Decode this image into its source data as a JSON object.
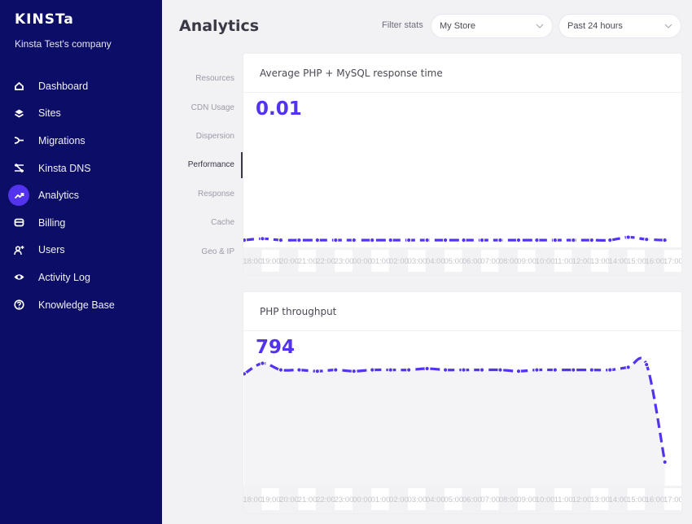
{
  "sidebar": {
    "logo": "KINSTa",
    "company": "Kinsta Test's company",
    "items": [
      {
        "label": "Dashboard",
        "icon": "home-icon",
        "active": false
      },
      {
        "label": "Sites",
        "icon": "layers-icon",
        "active": false
      },
      {
        "label": "Migrations",
        "icon": "migrate-icon",
        "active": false
      },
      {
        "label": "Kinsta DNS",
        "icon": "dns-icon",
        "active": false
      },
      {
        "label": "Analytics",
        "icon": "trend-up-icon",
        "active": true
      },
      {
        "label": "Billing",
        "icon": "card-icon",
        "active": false
      },
      {
        "label": "Users",
        "icon": "add-user-icon",
        "active": false
      },
      {
        "label": "Activity Log",
        "icon": "eye-icon",
        "active": false
      },
      {
        "label": "Knowledge Base",
        "icon": "help-icon",
        "active": false
      }
    ]
  },
  "header": {
    "title": "Analytics",
    "filter_label": "Filter stats",
    "site_select": "My Store",
    "range_select": "Past 24 hours"
  },
  "subnav": {
    "items": [
      {
        "label": "Resources",
        "active": false
      },
      {
        "label": "CDN Usage",
        "active": false
      },
      {
        "label": "Dispersion",
        "active": false
      },
      {
        "label": "Performance",
        "active": true
      },
      {
        "label": "Response",
        "active": false
      },
      {
        "label": "Cache",
        "active": false
      },
      {
        "label": "Geo & IP",
        "active": false
      }
    ]
  },
  "colors": {
    "accent": "#5333ed",
    "sidebar": "#0b0d66"
  },
  "cards": [
    {
      "title": "Average PHP + MySQL response time",
      "value": "0.01"
    },
    {
      "title": "PHP throughput",
      "value": "794"
    }
  ],
  "chart_data": [
    {
      "type": "line",
      "title": "Average PHP + MySQL response time",
      "xlabel": "",
      "ylabel": "",
      "x": [
        "18:00",
        "19:00",
        "20:00",
        "21:00",
        "22:00",
        "23:00",
        "00:00",
        "01:00",
        "02:00",
        "03:00",
        "04:00",
        "05:00",
        "06:00",
        "07:00",
        "08:00",
        "09:00",
        "10:00",
        "11:00",
        "12:00",
        "13:00",
        "14:00",
        "15:00",
        "16:00",
        "17:00"
      ],
      "series": [
        {
          "name": "Average PHP + MySQL response time",
          "values": [
            0.01,
            0.012,
            0.01,
            0.01,
            0.01,
            0.01,
            0.01,
            0.01,
            0.01,
            0.01,
            0.01,
            0.01,
            0.01,
            0.01,
            0.01,
            0.01,
            0.01,
            0.01,
            0.01,
            0.01,
            0.01,
            0.014,
            0.011,
            0.01
          ]
        }
      ],
      "ylim": [
        0,
        0.2
      ],
      "grid": false,
      "legend": "none"
    },
    {
      "type": "area",
      "title": "PHP throughput",
      "xlabel": "",
      "ylabel": "",
      "x": [
        "18:00",
        "19:00",
        "20:00",
        "21:00",
        "22:00",
        "23:00",
        "00:00",
        "01:00",
        "02:00",
        "03:00",
        "04:00",
        "05:00",
        "06:00",
        "07:00",
        "08:00",
        "09:00",
        "10:00",
        "11:00",
        "12:00",
        "13:00",
        "14:00",
        "15:00",
        "16:00",
        "17:00"
      ],
      "series": [
        {
          "name": "PHP throughput",
          "values": [
            850,
            930,
            880,
            880,
            870,
            880,
            870,
            880,
            880,
            880,
            890,
            880,
            880,
            880,
            880,
            870,
            880,
            880,
            880,
            880,
            880,
            900,
            920,
            180
          ]
        }
      ],
      "ylim": [
        0,
        1100
      ],
      "grid": false,
      "legend": "none"
    }
  ]
}
